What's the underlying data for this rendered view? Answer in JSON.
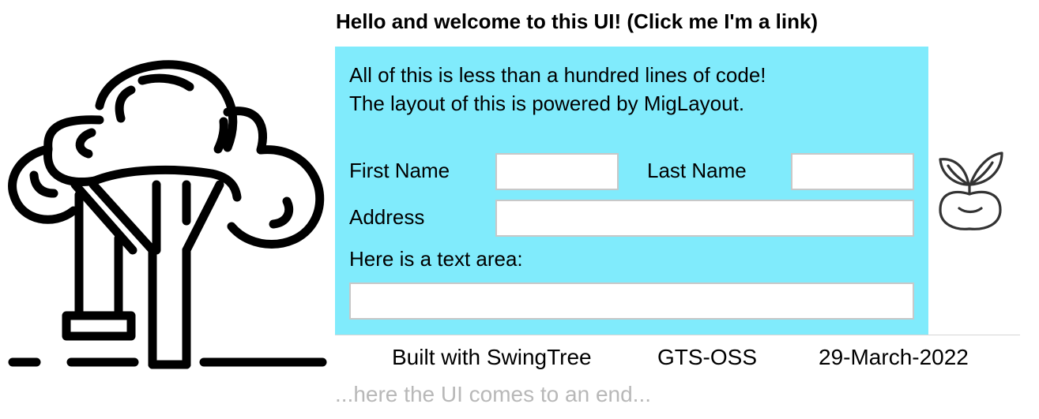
{
  "header": {
    "link_text": "Hello and welcome to this UI! (Click me I'm a link)"
  },
  "intro": {
    "line1": "All of this is less than a hundred lines of code!",
    "line2": "The layout of this is powered by MigLayout."
  },
  "form": {
    "first_name_label": "First Name",
    "first_name_value": "",
    "last_name_label": "Last Name",
    "last_name_value": "",
    "address_label": "Address",
    "address_value": "",
    "text_area_label": "Here is a text area:",
    "text_area_value": ""
  },
  "footer": {
    "built_with": "Built with SwingTree",
    "org": "GTS-OSS",
    "date": "29-March-2022",
    "end_note": "...here the UI comes to an end..."
  },
  "icons": {
    "left": "tree-icon",
    "right": "sprout-icon"
  },
  "colors": {
    "panel_background": "#80ebfc",
    "field_border": "#c8c8c8",
    "end_note": "#b8b8b8"
  }
}
